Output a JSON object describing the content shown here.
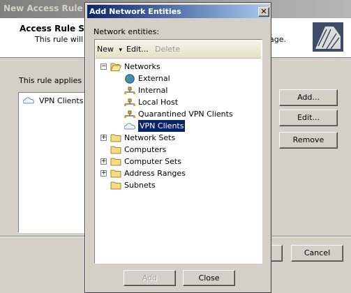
{
  "background_wizard": {
    "title": "New Access Rule Wa",
    "header_title": "Access Rule Sou",
    "header_desc": "This rule will ap",
    "header_desc_tail": "age.",
    "applies_label": "This rule applies to t",
    "list_item": "VPN Clients",
    "buttons": {
      "add": "Add...",
      "edit": "Edit...",
      "remove": "Remove",
      "cancel": "Cancel"
    }
  },
  "dialog": {
    "title": "Add Network Entities",
    "close_glyph": "✕",
    "entities_label": "Network entities:",
    "toolbar": {
      "new": "New",
      "new_arrow": "▾",
      "edit": "Edit...",
      "delete": "Delete"
    },
    "tree": [
      {
        "label": "Networks",
        "expander": "−",
        "icon": "folder-open-icon"
      },
      {
        "label": "External",
        "icon": "globe-icon"
      },
      {
        "label": "Internal",
        "icon": "network-icon"
      },
      {
        "label": "Local Host",
        "icon": "network-icon"
      },
      {
        "label": "Quarantined VPN Clients",
        "icon": "network-icon"
      },
      {
        "label": "VPN Clients",
        "icon": "cloud-icon",
        "selected": true
      },
      {
        "label": "Network Sets",
        "expander": "+",
        "icon": "folder-icon"
      },
      {
        "label": "Computers",
        "icon": "folder-icon"
      },
      {
        "label": "Computer Sets",
        "expander": "+",
        "icon": "folder-icon"
      },
      {
        "label": "Address Ranges",
        "expander": "+",
        "icon": "folder-icon"
      },
      {
        "label": "Subnets",
        "icon": "folder-icon"
      }
    ],
    "buttons": {
      "add": "Add",
      "close": "Close"
    }
  },
  "colors": {
    "title_active": "#0a246a",
    "title_inactive": "#808080",
    "face": "#d4d0c8",
    "selection": "#0a246a"
  }
}
